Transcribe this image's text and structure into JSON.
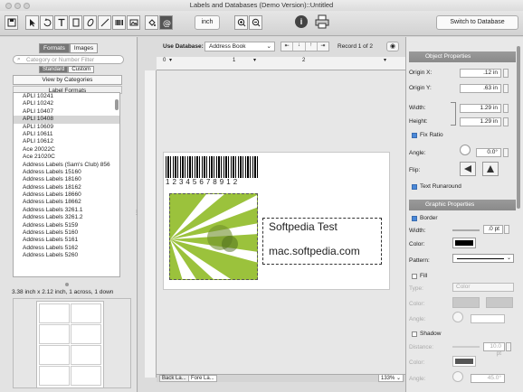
{
  "window": {
    "title": "Labels and Databases (Demo Version)::Untitled"
  },
  "toolbar": {
    "unit_label": "inch",
    "switch_label": "Switch to Database"
  },
  "left": {
    "tabs": [
      "Formats",
      "Images"
    ],
    "search_placeholder": "Category or Number Filter",
    "subtabs": [
      "Standard",
      "Custom"
    ],
    "view_by": "View by Categories",
    "list_header": "Label Formats",
    "items": [
      "APLI 10241",
      "APLI 10242",
      "APLI 10407",
      "APLI 10408",
      "APLI 10609",
      "APLI 10611",
      "APLI 10612",
      "Ace 20022C",
      "Ace 21020C",
      "Address Labels (Sam's Club) 856",
      "Address Labels 15160",
      "Address Labels 18160",
      "Address Labels 18162",
      "Address Labels 18660",
      "Address Labels 18662",
      "Address Labels 3261.1",
      "Address Labels 3261.2",
      "Address Labels 5159",
      "Address Labels 5160",
      "Address Labels 5161",
      "Address Labels 5162",
      "Address Labels 5260"
    ],
    "selected_index": 3,
    "format_info": "3.38 inch x 2.12 inch, 1 across, 1 down"
  },
  "editor": {
    "use_db_label": "Use Database:",
    "db_value": "Address Book",
    "record": "Record 1 of 2",
    "ruler_numbers": [
      "0",
      "1",
      "2"
    ],
    "barcode_digits": "1 2 3 4 5 6 7 8 9 1 2",
    "text_line1": "Softpedia Test",
    "text_line2": "mac.softpedia.com",
    "tab_back": "Back La...",
    "tab_fore": "Fore La...",
    "zoom": "133%"
  },
  "props": {
    "object_header": "Object Properties",
    "origin_x_label": "Origin X:",
    "origin_x": ".12 in",
    "origin_y_label": "Origin Y:",
    "origin_y": ".63 in",
    "width_label": "Width:",
    "width": "1.29 in",
    "height_label": "Height:",
    "height": "1.29 in",
    "fix_ratio": "Fix Ratio",
    "angle_label": "Angle:",
    "angle": "0.0°",
    "flip_label": "Flip:",
    "text_runaround": "Text Runaround",
    "graphic_header": "Graphic Properties",
    "border": "Border",
    "border_width_label": "Width:",
    "border_width": ".0 pt",
    "color_label": "Color:",
    "pattern_label": "Pattern:",
    "fill": "Fill",
    "type_label": "Type:",
    "type_value": "Color",
    "fill_color_label": "Color:",
    "fill_angle_label": "Angle:",
    "shadow": "Shadow",
    "distance_label": "Distance:",
    "distance": "10.0 pt",
    "shadow_color_label": "Color:",
    "shadow_angle_label": "Angle:",
    "shadow_angle": "45.0°"
  },
  "colors": {
    "accent_blue": "#4a88d8",
    "image_green": "#9bc23c",
    "header_gray": "#8e8e8e"
  }
}
